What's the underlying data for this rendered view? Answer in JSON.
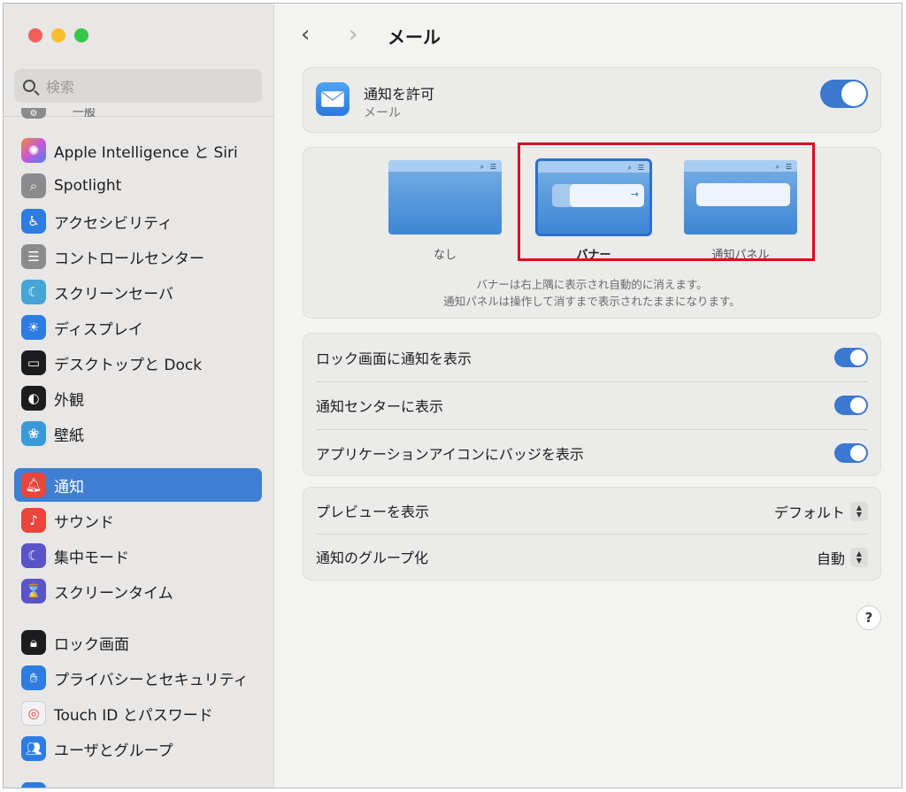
{
  "sidebar": {
    "search_placeholder": "検索",
    "cut_item_label": "一般",
    "items": [
      {
        "label": "Apple Intelligence と Siri",
        "icon": "siri-icon",
        "color": "#b45bd6"
      },
      {
        "label": "Spotlight",
        "icon": "spotlight-icon",
        "color": "#8b8b8d"
      },
      {
        "label": "アクセシビリティ",
        "icon": "accessibility-icon",
        "color": "#2d7de0"
      },
      {
        "label": "コントロールセンター",
        "icon": "control-center-icon",
        "color": "#8b8b8d"
      },
      {
        "label": "スクリーンセーバ",
        "icon": "screensaver-icon",
        "color": "#46a4d6"
      },
      {
        "label": "ディスプレイ",
        "icon": "display-icon",
        "color": "#2d7de0"
      },
      {
        "label": "デスクトップと Dock",
        "icon": "dock-icon",
        "color": "#1c1c1e"
      },
      {
        "label": "外観",
        "icon": "appearance-icon",
        "color": "#1c1c1e"
      },
      {
        "label": "壁紙",
        "icon": "wallpaper-icon",
        "color": "#3a9ad9"
      },
      {
        "label": "通知",
        "icon": "notifications-icon",
        "color": "#e8453c",
        "active": true
      },
      {
        "label": "サウンド",
        "icon": "sound-icon",
        "color": "#e8453c"
      },
      {
        "label": "集中モード",
        "icon": "focus-icon",
        "color": "#5a54c9"
      },
      {
        "label": "スクリーンタイム",
        "icon": "screen-time-icon",
        "color": "#5a54c9"
      },
      {
        "label": "ロック画面",
        "icon": "lock-screen-icon",
        "color": "#1c1c1e"
      },
      {
        "label": "プライバシーとセキュリティ",
        "icon": "privacy-hand-icon",
        "color": "#2d7de0"
      },
      {
        "label": "Touch ID とパスワード",
        "icon": "touch-id-icon",
        "color": "#f2f2f2"
      },
      {
        "label": "ユーザとグループ",
        "icon": "users-icon",
        "color": "#2d7de0"
      }
    ]
  },
  "header": {
    "title": "メール"
  },
  "allow": {
    "title": "通知を許可",
    "subtitle": "メール",
    "enabled": true
  },
  "alert_style": {
    "options": [
      {
        "label": "なし",
        "selected": false
      },
      {
        "label": "バナー",
        "selected": true
      },
      {
        "label": "通知パネル",
        "selected": false
      }
    ],
    "caption_1": "バナーは右上隅に表示され自動的に消えます。",
    "caption_2": "通知パネルは操作して消すまで表示されたままになります。"
  },
  "toggles": [
    {
      "label": "ロック画面に通知を表示",
      "enabled": true
    },
    {
      "label": "通知センターに表示",
      "enabled": true
    },
    {
      "label": "アプリケーションアイコンにバッジを表示",
      "enabled": true
    }
  ],
  "popups": [
    {
      "label": "プレビューを表示",
      "value": "デフォルト"
    },
    {
      "label": "通知のグループ化",
      "value": "自動"
    }
  ],
  "help_label": "?",
  "accent_color": "#3b79d0",
  "highlight_color": "#d90f1c"
}
